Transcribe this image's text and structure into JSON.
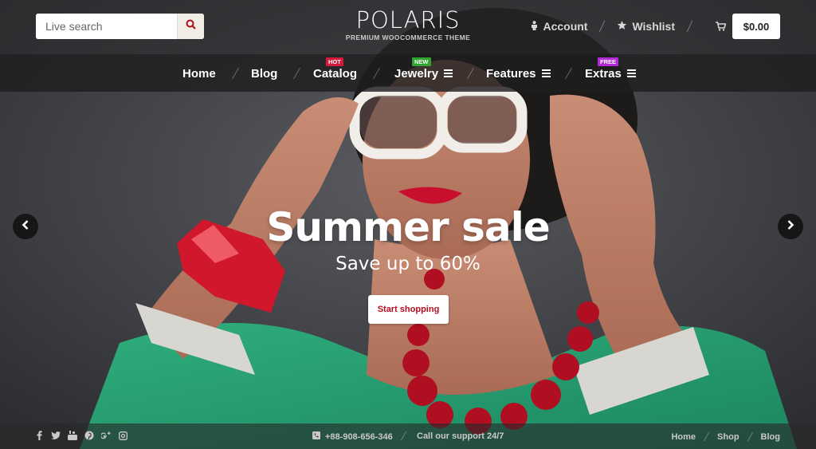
{
  "search": {
    "placeholder": "Live search"
  },
  "logo": {
    "title": "POLARIS",
    "subtitle": "PREMIUM WOOCOMMERCE THEME"
  },
  "account": {
    "account_label": "Account",
    "wishlist_label": "Wishlist"
  },
  "cart": {
    "total": "$0.00"
  },
  "nav": {
    "items": [
      {
        "label": "Home"
      },
      {
        "label": "Blog"
      },
      {
        "label": "Catalog",
        "badge": "HOT"
      },
      {
        "label": "Jewelry",
        "badge": "NEW"
      },
      {
        "label": "Features"
      },
      {
        "label": "Extras",
        "badge": "FREE"
      }
    ]
  },
  "colors": {
    "hot": "#d6193b",
    "new": "#2ea52e",
    "free": "#b12ad6",
    "accent": "#b30d1f"
  },
  "hero": {
    "title": "Summer sale",
    "subtitle": "Save up to 60%",
    "cta_label": "Start shopping"
  },
  "footer": {
    "social_icons": [
      "facebook-icon",
      "twitter-icon",
      "youtube-icon",
      "pinterest-icon",
      "google-plus-icon",
      "instagram-icon"
    ],
    "phone": "+88-908-656-346",
    "support": "Call our support 24/7",
    "links": [
      {
        "label": "Home"
      },
      {
        "label": "Shop"
      },
      {
        "label": "Blog"
      }
    ]
  }
}
